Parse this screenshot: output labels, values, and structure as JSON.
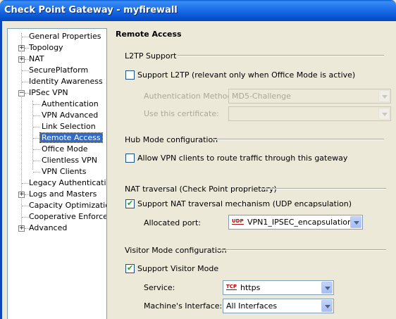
{
  "window": {
    "title": "Check Point Gateway - myfirewall"
  },
  "tree": {
    "items": [
      {
        "label": "General Properties",
        "expandable": false
      },
      {
        "label": "Topology",
        "expandable": true
      },
      {
        "label": "NAT",
        "expandable": true
      },
      {
        "label": "SecurePlatform",
        "expandable": false
      },
      {
        "label": "Identity Awareness",
        "expandable": false
      },
      {
        "label": "IPSec VPN",
        "expandable": true,
        "expanded": true
      },
      {
        "label": "Authentication",
        "child": true
      },
      {
        "label": "VPN Advanced",
        "child": true
      },
      {
        "label": "Link Selection",
        "child": true
      },
      {
        "label": "Remote Access",
        "child": true,
        "selected": true
      },
      {
        "label": "Office Mode",
        "child": true
      },
      {
        "label": "Clientless VPN",
        "child": true
      },
      {
        "label": "VPN Clients",
        "child": true
      },
      {
        "label": "Legacy Authentication",
        "expandable": false
      },
      {
        "label": "Logs and Masters",
        "expandable": true
      },
      {
        "label": "Capacity Optimization",
        "expandable": false
      },
      {
        "label": "Cooperative Enforcement",
        "expandable": false
      },
      {
        "label": "Advanced",
        "expandable": true
      }
    ]
  },
  "page": {
    "heading": "Remote Access",
    "l2tp": {
      "group_title": "L2TP Support",
      "checkbox_label": "Support L2TP (relevant only when Office Mode is active)",
      "checked": false,
      "auth_method_label": "Authentication Method:",
      "auth_method_value": "MD5-Challenge",
      "certificate_label": "Use this certificate:",
      "certificate_value": ""
    },
    "hub": {
      "group_title": "Hub Mode configuration",
      "checkbox_label": "Allow VPN clients to route traffic through this gateway",
      "checked": false
    },
    "nat": {
      "group_title": "NAT traversal (Check Point proprietary)",
      "checkbox_label": "Support NAT traversal mechanism (UDP encapsulation)",
      "checked": true,
      "port_label": "Allocated port:",
      "port_protocol": "UDP",
      "port_value": "VPN1_IPSEC_encapsulation"
    },
    "visitor": {
      "group_title": "Visitor Mode configuration",
      "checkbox_label": "Support Visitor Mode",
      "checked": true,
      "service_label": "Service:",
      "service_protocol": "TCP",
      "service_value": "https",
      "interface_label": "Machine's Interface:",
      "interface_value": "All Interfaces"
    }
  },
  "colors": {
    "title_bar": "#0A5FD8",
    "selection": "#316AC5",
    "dialog_bg": "#ECE9D8"
  }
}
